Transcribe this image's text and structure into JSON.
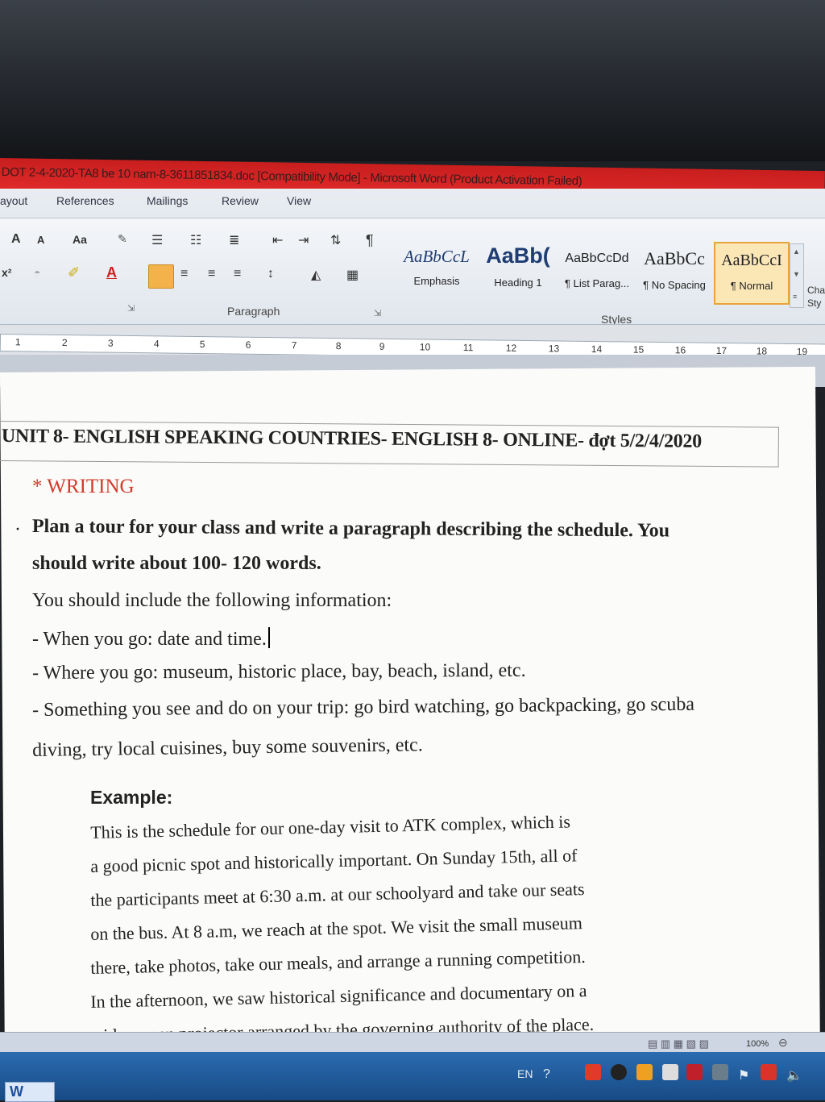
{
  "window": {
    "title": "DOT 2-4-2020-TA8 be 10 nam-8-3611851834.doc [Compatibility Mode] - Microsoft Word (Product Activation Failed)"
  },
  "ribbon": {
    "tabs": [
      "ayout",
      "References",
      "Mailings",
      "Review",
      "View"
    ],
    "font_buttons": {
      "grow": "A",
      "shrink": "A",
      "change_case": "Aa"
    },
    "paragraph_label": "Paragraph",
    "styles_label": "Styles",
    "change_styles_label": "Cha Sty",
    "styles": [
      {
        "sample": "AaBbCcL",
        "name": "Emphasis"
      },
      {
        "sample": "AaBb(",
        "name": "Heading 1"
      },
      {
        "sample": "AaBbCcDd",
        "name": "¶ List Parag..."
      },
      {
        "sample": "AaBbCc",
        "name": "¶ No Spacing"
      },
      {
        "sample": "AaBbCcI",
        "name": "¶ Normal"
      }
    ]
  },
  "ruler": {
    "ticks": [
      "1",
      "2",
      "3",
      "4",
      "5",
      "6",
      "7",
      "8",
      "9",
      "10",
      "11",
      "12",
      "13",
      "14",
      "15",
      "16",
      "17",
      "18",
      "19"
    ]
  },
  "document": {
    "heading": "UNIT 8- ENGLISH SPEAKING COUNTRIES- ENGLISH 8- ONLINE- đợt 5/2/4/2020",
    "section": "* WRITING",
    "task_line1": "Plan a tour for your class and write a paragraph describing the schedule. You",
    "task_line2": "should write about 100- 120 words.",
    "info_intro": "You should include the following information:",
    "bullet_when": "- When you go: date and time.",
    "bullet_where": "- Where you go: museum, historic place, bay, beach, island, etc.",
    "bullet_something_1": "- Something you see and do on your trip: go bird watching, go backpacking, go scuba",
    "bullet_something_2": "diving, try local cuisines, buy some souvenirs, etc.",
    "example_title": "Example:",
    "example_lines": [
      "This is the schedule for our one-day visit to ATK complex, which is",
      "a good picnic spot and historically important. On Sunday 15th, all of",
      "the participants meet at 6:30 a.m. at our schoolyard and take our seats",
      "on the bus. At 8 a.m, we reach at the spot. We visit the small museum",
      "there, take photos, take our meals, and arrange a running competition.",
      "In the afternoon, we saw historical significance and documentary on a",
      "wide screen projector arranged by the governing authority of the place."
    ]
  },
  "statusbar": {
    "zoom": "100%"
  },
  "taskbar": {
    "language": "EN"
  },
  "colors": {
    "titlebar": "#d42424",
    "heading_accent": "#d23b2b",
    "selected_style": "#e8a43c"
  }
}
